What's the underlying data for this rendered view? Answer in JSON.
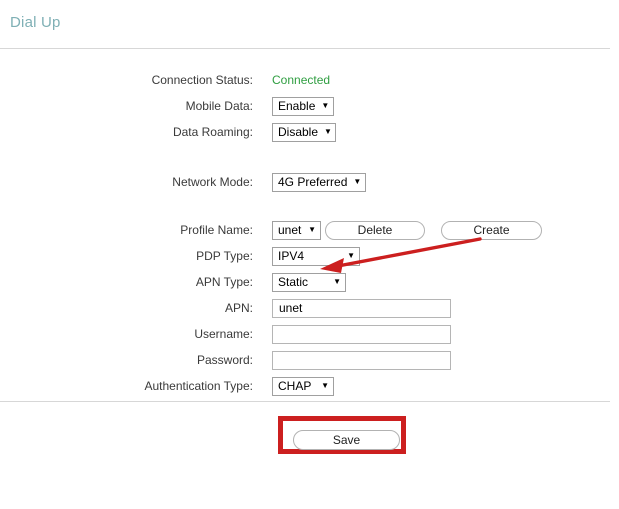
{
  "header": {
    "title": "Dial Up"
  },
  "form": {
    "rows": [
      {
        "label": "Connection Status:",
        "type": "status",
        "value": "Connected"
      },
      {
        "label": "Mobile Data:",
        "type": "select",
        "value": "Enable"
      },
      {
        "label": "Data Roaming:",
        "type": "select",
        "value": "Disable"
      },
      {
        "label": "Network Mode:",
        "type": "select",
        "value": "4G Preferred"
      },
      {
        "label": "Profile Name:",
        "type": "select-buttons",
        "value": "unet"
      },
      {
        "label": "PDP Type:",
        "type": "select",
        "value": "IPV4"
      },
      {
        "label": "APN Type:",
        "type": "select",
        "value": "Static"
      },
      {
        "label": "APN:",
        "type": "text",
        "value": "unet",
        "placeholder": ""
      },
      {
        "label": "Username:",
        "type": "text",
        "value": "",
        "placeholder": ""
      },
      {
        "label": "Password:",
        "type": "password",
        "value": "",
        "placeholder": ""
      },
      {
        "label": "Authentication Type:",
        "type": "select",
        "value": "CHAP"
      }
    ],
    "buttons": {
      "delete_label": "Delete",
      "create_label": "Create"
    }
  },
  "footer": {
    "save_label": "Save"
  },
  "icons": {
    "caret_down": "▼"
  },
  "colors": {
    "title": "#7fb0b5",
    "status_connected": "#2f9e41",
    "annotation_red": "#cc1f1f",
    "divider": "#d7d7d7"
  }
}
